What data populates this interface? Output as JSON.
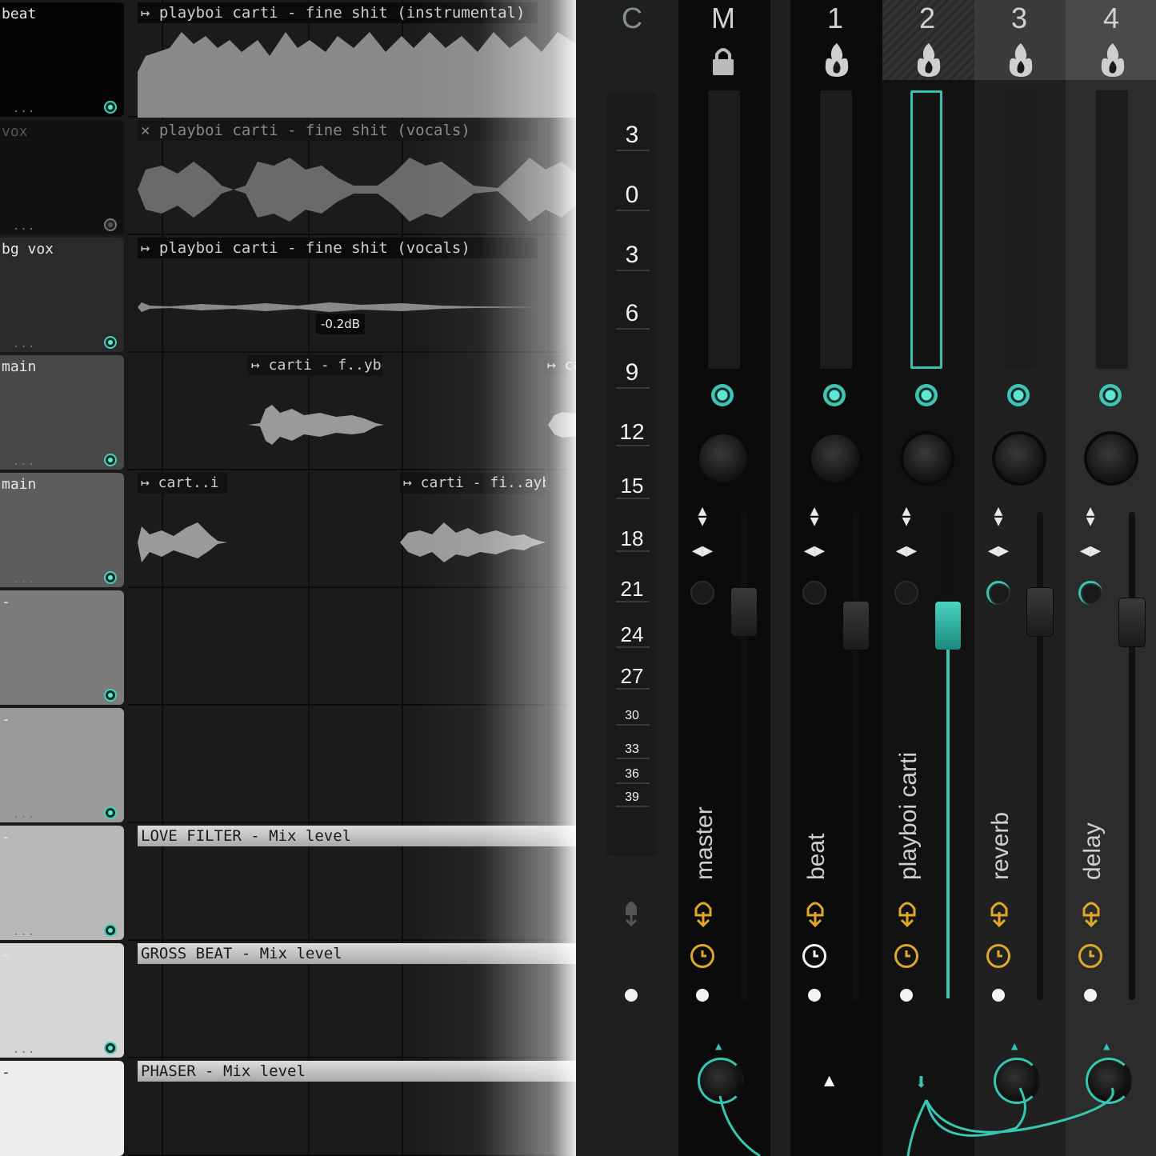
{
  "playlist": {
    "tracks": [
      {
        "name": "beat",
        "dots": "...",
        "led": "on"
      },
      {
        "name": "vox",
        "dots": "...",
        "led": "off"
      },
      {
        "name": "bg vox",
        "dots": "...",
        "led": "on"
      },
      {
        "name": "main",
        "dots": "...",
        "led": "on"
      },
      {
        "name": "main",
        "dots": "...",
        "led": "on"
      },
      {
        "name": "-",
        "dots": "...",
        "led": "on"
      },
      {
        "name": "-",
        "dots": "...",
        "led": "on"
      },
      {
        "name": "-",
        "dots": "...",
        "led": "on"
      },
      {
        "name": "-",
        "dots": "...",
        "led": "on"
      },
      {
        "name": "-",
        "dots": "",
        "led": "none"
      }
    ],
    "clips": {
      "instrumental": "↦ playboi carti - fine shit (instrumental)",
      "vocals_muted": "✕ playboi carti - fine shit (vocals)",
      "vocals": "↦ playboi carti - fine shit (vocals)",
      "main_clip_a": "↦ carti - f..yboi carti",
      "main_clip_a2": "↦ ca",
      "main2_clip_a": "↦ cart..i carti",
      "main2_clip_b": "↦ carti - fi..ayboi carti"
    },
    "volume_hint": "-0.2dB",
    "automation": {
      "love_filter": "LOVE FILTER - Mix level",
      "gross_beat": "GROSS BEAT - Mix level",
      "phaser": "PHASER - Mix level"
    }
  },
  "mixer": {
    "ruler": [
      "3",
      "0",
      "3",
      "6",
      "9",
      "12",
      "15",
      "18",
      "21",
      "24",
      "27",
      "30",
      "33",
      "36",
      "39"
    ],
    "current_label": "C",
    "strips": [
      {
        "number": "M",
        "name": "master",
        "icon": "lock-icon"
      },
      {
        "number": "1",
        "name": "beat",
        "icon": "flame-icon"
      },
      {
        "number": "2",
        "name": "playboi carti",
        "icon": "flame-icon",
        "selected": true
      },
      {
        "number": "3",
        "name": "reverb",
        "icon": "flame-icon"
      },
      {
        "number": "4",
        "name": "delay",
        "icon": "flame-icon"
      }
    ],
    "accent": "#38c1b0",
    "warning": "#e0a82a"
  }
}
